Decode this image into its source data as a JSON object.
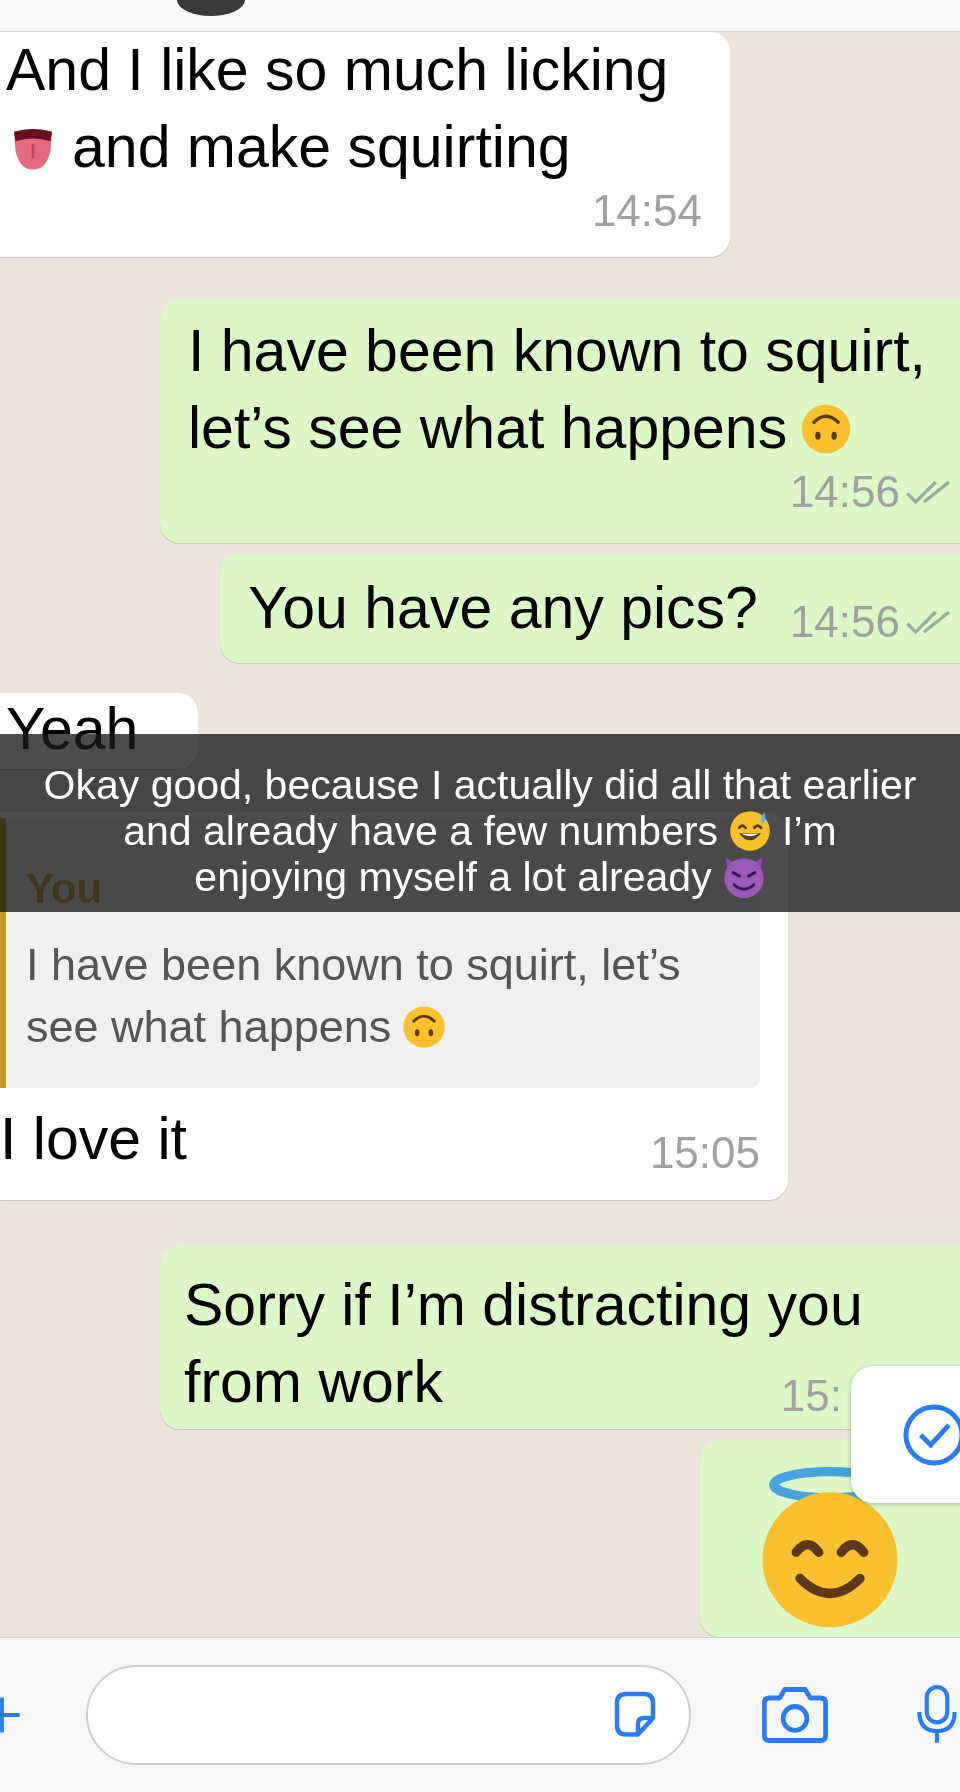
{
  "messages": [
    {
      "outgoing": false,
      "kind": "text",
      "lines": [
        [
          {
            "kind": "text",
            "text": "And I like so much licking"
          }
        ],
        [
          {
            "kind": "tongue"
          },
          {
            "kind": "text",
            "text": "and make squirting"
          }
        ]
      ],
      "time": "14:54"
    },
    {
      "outgoing": true,
      "kind": "text",
      "lines": [
        [
          {
            "kind": "text",
            "text": "I have been known to squirt,"
          }
        ],
        [
          {
            "kind": "text",
            "text": "let’s see what happens"
          },
          {
            "kind": "upside-down"
          }
        ]
      ],
      "time": "14:56",
      "read": false
    },
    {
      "outgoing": true,
      "kind": "text",
      "lines": [
        [
          {
            "kind": "text",
            "text": "You have any pics?"
          }
        ]
      ],
      "time": "14:56",
      "read": false
    },
    {
      "outgoing": false,
      "kind": "text",
      "lines": [
        [
          {
            "kind": "text",
            "text": "Yeah"
          }
        ]
      ]
    },
    {
      "outgoing": false,
      "kind": "reply",
      "quote": {
        "author": "You",
        "lines": [
          [
            {
              "kind": "text",
              "text": "I have been known to squirt, let’s"
            }
          ],
          [
            {
              "kind": "text",
              "text": "see what happens"
            },
            {
              "kind": "upside-down"
            }
          ]
        ]
      },
      "lines": [
        [
          {
            "kind": "text",
            "text": "I love it"
          }
        ]
      ],
      "time": "15:05"
    },
    {
      "outgoing": true,
      "kind": "text",
      "lines": [
        [
          {
            "kind": "text",
            "text": "Sorry if I’m distracting you"
          }
        ],
        [
          {
            "kind": "text",
            "text": "from work"
          }
        ]
      ],
      "time": "15:"
    },
    {
      "outgoing": true,
      "kind": "emoji",
      "lines": [
        [
          {
            "kind": "halo"
          }
        ]
      ]
    }
  ],
  "caption": {
    "lines": [
      [
        {
          "kind": "text",
          "text": "Okay good, because I actually did all that earlier"
        }
      ],
      [
        {
          "kind": "text",
          "text": "and already have a few numbers"
        },
        {
          "kind": "sweat-smile"
        },
        {
          "kind": "text",
          "text": "I’m"
        }
      ],
      [
        {
          "kind": "text",
          "text": "enjoying myself a lot already"
        },
        {
          "kind": "devil"
        }
      ]
    ]
  }
}
